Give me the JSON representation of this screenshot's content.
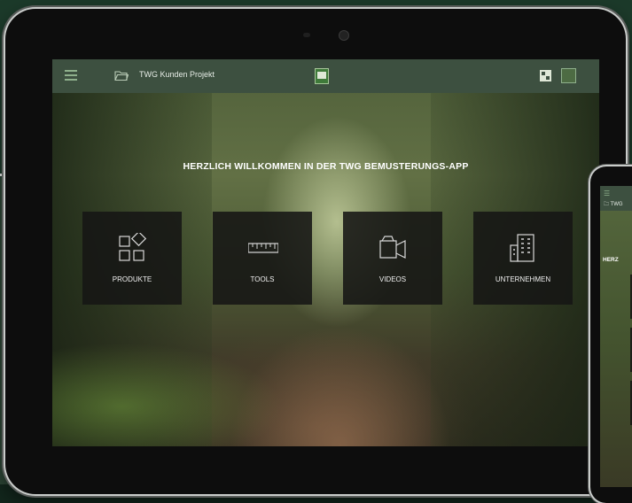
{
  "topbar": {
    "project_title": "TWG Kunden Projekt"
  },
  "welcome_text": "HERZLICH WILLKOMMEN IN DER TWG BEMUSTERUNGS-APP",
  "tiles": [
    {
      "label": "PRODUKTE",
      "icon": "products-icon"
    },
    {
      "label": "TOOLS",
      "icon": "ruler-icon"
    },
    {
      "label": "VIDEOS",
      "icon": "video-camera-icon"
    },
    {
      "label": "UNTERNEHMEN",
      "icon": "building-icon"
    }
  ],
  "phone": {
    "title": "TWG",
    "welcome": "HERZ"
  },
  "colors": {
    "background_top": "#1c3a2a",
    "background_bottom": "#2c4535",
    "topbar": "#3d5040",
    "accent_green": "#8fb08c",
    "tile": "#161614"
  }
}
